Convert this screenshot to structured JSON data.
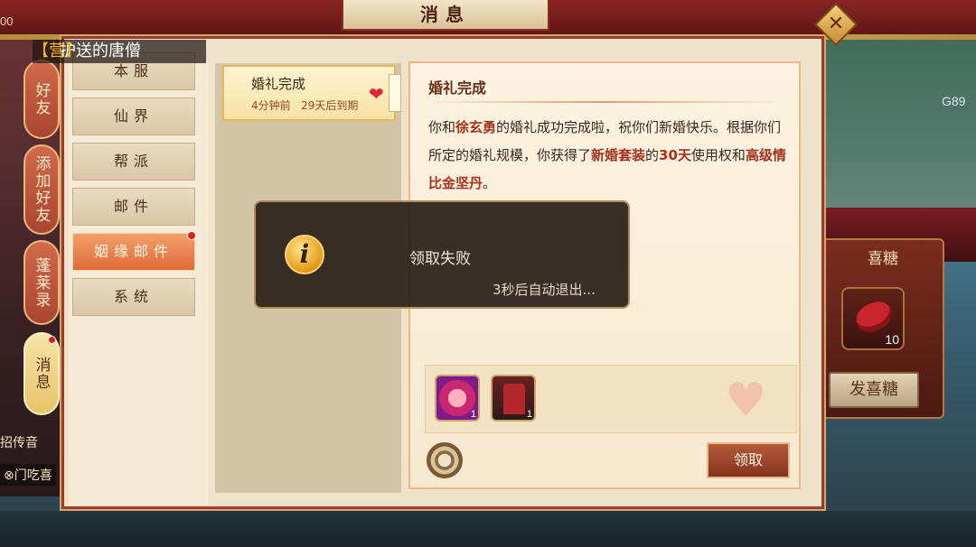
{
  "window": {
    "title": "消息",
    "close_icon": "✕"
  },
  "hud": {
    "top_left_num": "00",
    "coord_text": "G89"
  },
  "notice": {
    "tag": "【营】",
    "text": "护送的唐僧"
  },
  "side_tabs": [
    {
      "label": "好友",
      "active": false,
      "badge": false
    },
    {
      "label": "添加好友",
      "active": false,
      "badge": false
    },
    {
      "label": "蓬莱录",
      "active": false,
      "badge": false
    },
    {
      "label": "消息",
      "active": true,
      "badge": true
    }
  ],
  "bottom_left": {
    "line1": "招传音",
    "line2": "⊗门吃喜"
  },
  "categories": [
    {
      "label": "本服",
      "active": false,
      "badge": false
    },
    {
      "label": "仙界",
      "active": false,
      "badge": false
    },
    {
      "label": "帮派",
      "active": false,
      "badge": false
    },
    {
      "label": "邮件",
      "active": false,
      "badge": false
    },
    {
      "label": "姻缘邮件",
      "active": true,
      "badge": true
    },
    {
      "label": "系统",
      "active": false,
      "badge": false
    }
  ],
  "mail_list": [
    {
      "title": "婚礼完成",
      "time": "4分钟前",
      "expire": "29天后到期"
    }
  ],
  "mail_detail": {
    "title": "婚礼完成",
    "p1": "你和",
    "name": "徐玄勇",
    "p2": "的婚礼成功完成啦，祝你们新婚快乐。根据你们所定的婚礼规模，你获得了",
    "item1": "新婚套装",
    "p3": "的",
    "days": "30天",
    "p4": "使用权和",
    "item2": "高级情比金坚丹",
    "p5": "。",
    "rewards": [
      {
        "count": "1"
      },
      {
        "count": "1"
      }
    ],
    "claim_label": "领取"
  },
  "candy_panel": {
    "title": "喜糖",
    "count": "10",
    "button": "发喜糖"
  },
  "toast": {
    "message": "领取失败",
    "sub": "3秒后自动退出...",
    "icon": "i"
  }
}
